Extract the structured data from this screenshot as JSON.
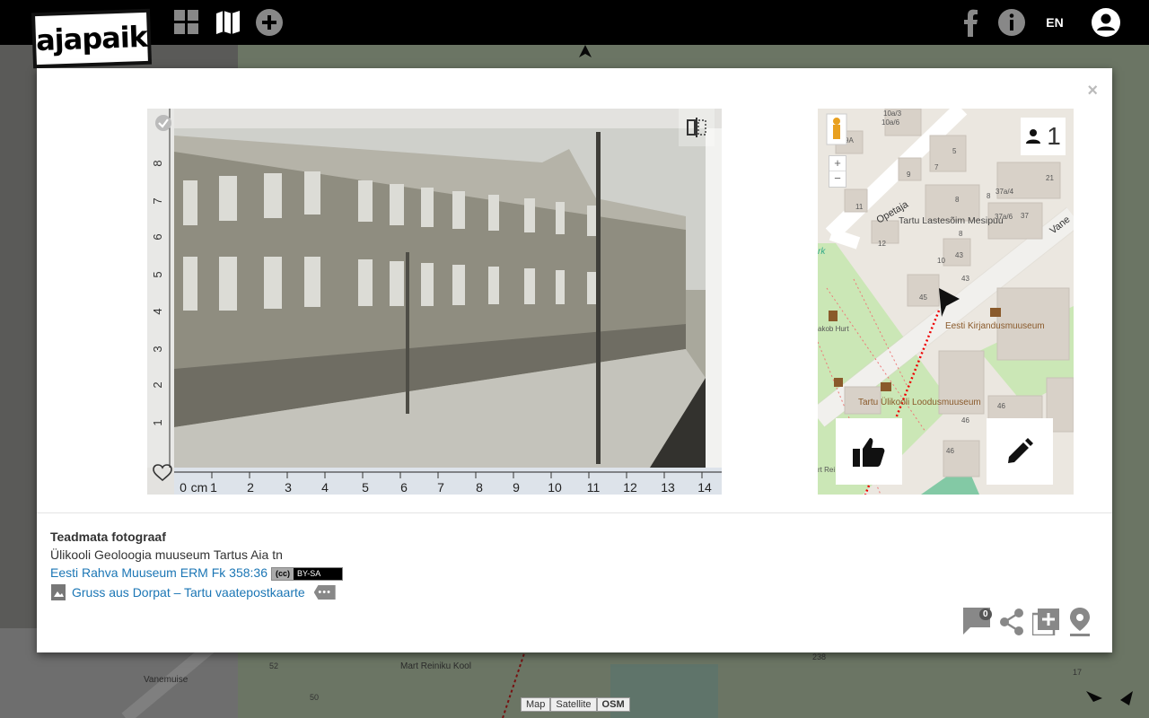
{
  "app": {
    "logo_text": "ajapaik",
    "language": "EN"
  },
  "nav": {
    "icons": [
      "grid-icon",
      "map-icon",
      "add-icon"
    ],
    "right_icons": [
      "facebook-icon",
      "info-icon",
      "user-icon"
    ]
  },
  "modal": {
    "close_label": "×",
    "photo": {
      "ruler_numbers": [
        "1",
        "2",
        "3",
        "4",
        "5",
        "6",
        "7",
        "8",
        "9",
        "10",
        "11",
        "12",
        "13",
        "14"
      ],
      "ruler_unit": "cm",
      "ruler_zero": "0"
    },
    "minimap": {
      "viewer_count": "1",
      "zoom_in": "+",
      "zoom_out": "−",
      "labels": {
        "street_opetaja": "Opetaja",
        "street_vane": "Vane",
        "school": "Tartu Lastesõim Mesipuu",
        "museum1": "Eesti Kirjandusmuuseum",
        "museum2": "Tartu Ülikooli Loodusmuuseum",
        "jakob": "akob Hurt",
        "park": "rk",
        "bottom": "rt Rei Koo"
      },
      "house_numbers": [
        "10a/3",
        "10a/6",
        "9A",
        "5",
        "9",
        "7",
        "11",
        "8",
        "8",
        "37a/4",
        "37a/6",
        "37",
        "21",
        "12",
        "8",
        "10",
        "43",
        "45",
        "43",
        "46",
        "46",
        "46"
      ]
    },
    "info": {
      "author": "Teadmata fotograaf",
      "description": "Ülikooli Geoloogia muuseum Tartus Aia tn",
      "source_link": "Eesti Rahva Muuseum ERM Fk 358:36",
      "license": {
        "cc": "(cc)",
        "text": "BY-SA"
      },
      "album_link": "Gruss aus Dorpat – Tartu vaatepostkaarte"
    },
    "actions": {
      "comments_count": "0"
    }
  },
  "background_map": {
    "labels": [
      "Vanemuise",
      "Mart Reiniku Kool",
      "52",
      "50",
      "238",
      "17"
    ],
    "attribution": [
      "Map",
      "Satellite",
      "OSM"
    ]
  },
  "colors": {
    "link": "#1b76b5",
    "topbar": "#000000",
    "map_green": "#c9e6b5"
  }
}
